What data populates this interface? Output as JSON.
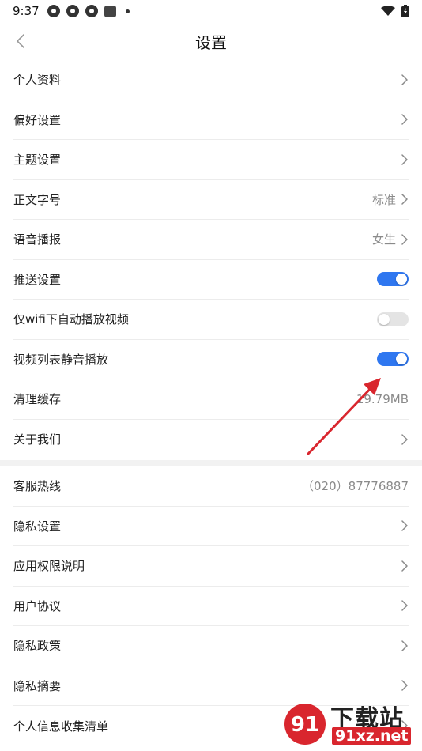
{
  "status_bar": {
    "time": "9:37"
  },
  "nav": {
    "title": "设置"
  },
  "group1": [
    {
      "label": "个人资料",
      "type": "chevron",
      "value": ""
    },
    {
      "label": "偏好设置",
      "type": "chevron",
      "value": ""
    },
    {
      "label": "主题设置",
      "type": "chevron",
      "value": ""
    },
    {
      "label": "正文字号",
      "type": "chevron",
      "value": "标准"
    },
    {
      "label": "语音播报",
      "type": "chevron",
      "value": "女生"
    },
    {
      "label": "推送设置",
      "type": "toggle",
      "on": true
    },
    {
      "label": "仅wifi下自动播放视频",
      "type": "toggle",
      "on": false
    },
    {
      "label": "视频列表静音播放",
      "type": "toggle",
      "on": true
    },
    {
      "label": "清理缓存",
      "type": "value",
      "value": "19.79MB"
    },
    {
      "label": "关于我们",
      "type": "chevron",
      "value": ""
    }
  ],
  "group2": [
    {
      "label": "客服热线",
      "type": "value",
      "value": "（020）87776887"
    },
    {
      "label": "隐私设置",
      "type": "chevron",
      "value": ""
    },
    {
      "label": "应用权限说明",
      "type": "chevron",
      "value": ""
    },
    {
      "label": "用户协议",
      "type": "chevron",
      "value": ""
    },
    {
      "label": "隐私政策",
      "type": "chevron",
      "value": ""
    },
    {
      "label": "隐私摘要",
      "type": "chevron",
      "value": ""
    },
    {
      "label": "个人信息收集清单",
      "type": "chevron",
      "value": ""
    }
  ],
  "watermark": {
    "logo_text": "91",
    "title": "下载站",
    "site": "91xz.net"
  },
  "colors": {
    "accent": "#2f77f0",
    "toggle_off": "#e4e4e4",
    "annotation_arrow": "#d9262e"
  }
}
